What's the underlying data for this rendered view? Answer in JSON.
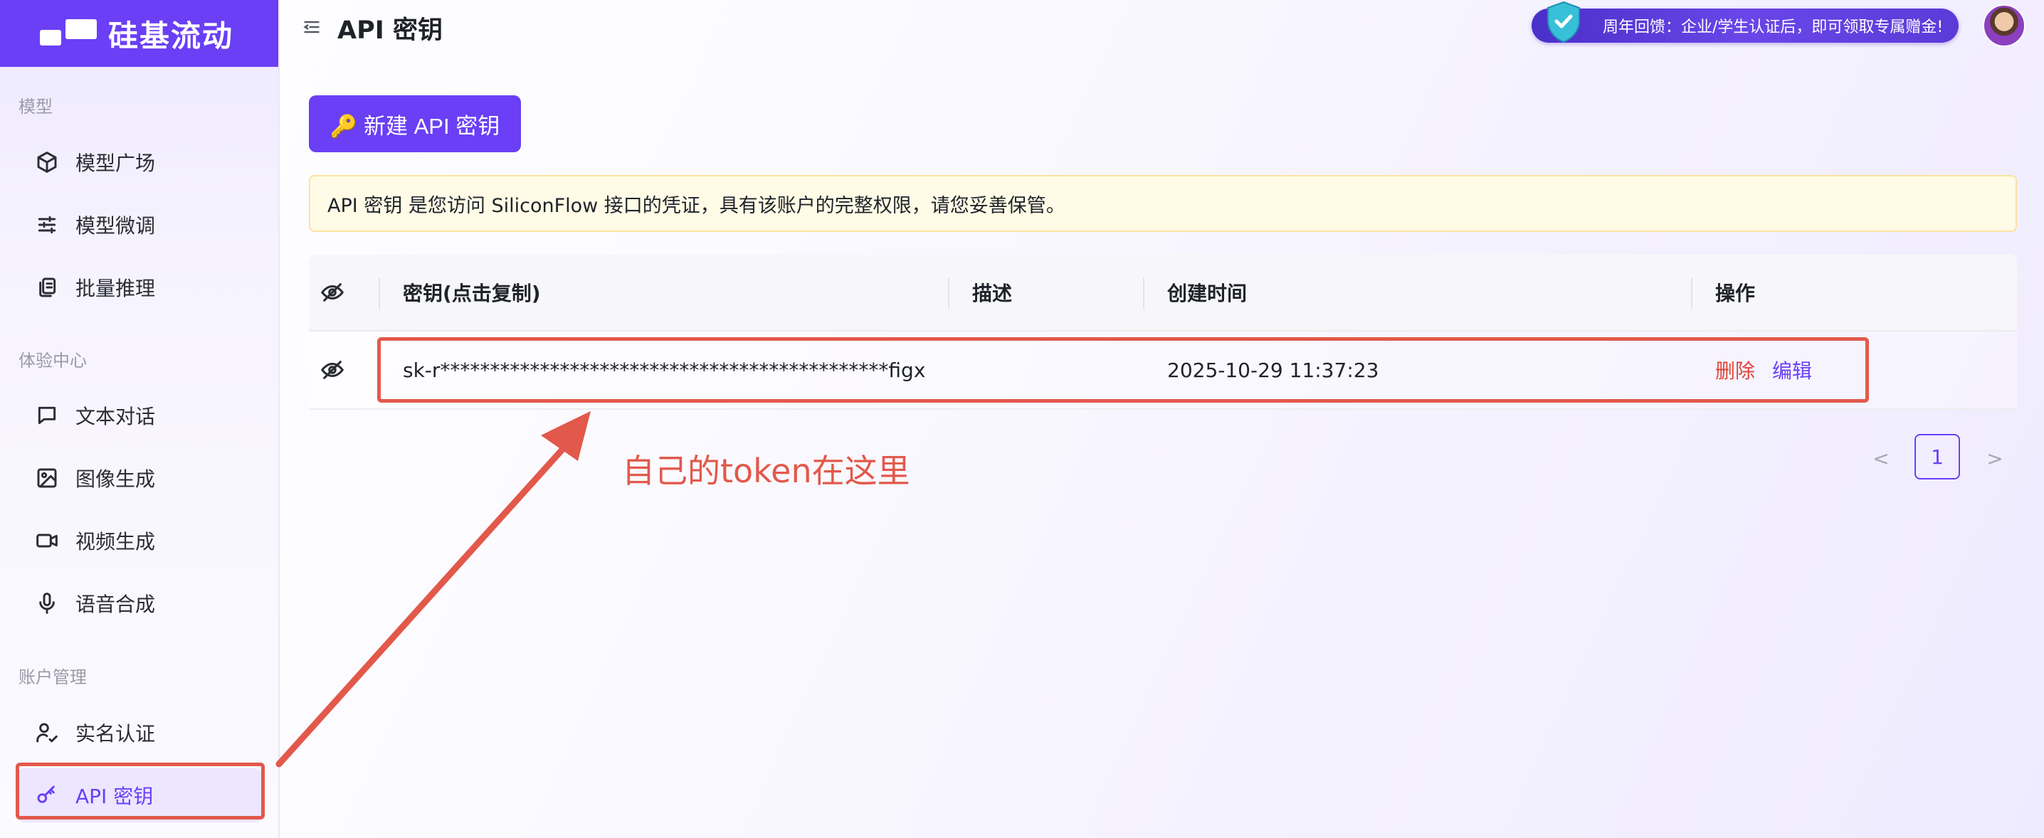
{
  "brand": {
    "name": "硅基流动"
  },
  "sidebar": {
    "sections": [
      {
        "title": "模型"
      },
      {
        "title": "体验中心"
      },
      {
        "title": "账户管理"
      }
    ],
    "items": [
      {
        "label": "模型广场",
        "icon": "cube-icon"
      },
      {
        "label": "模型微调",
        "icon": "sliders-icon"
      },
      {
        "label": "批量推理",
        "icon": "copy-icon"
      },
      {
        "label": "文本对话",
        "icon": "chat-icon"
      },
      {
        "label": "图像生成",
        "icon": "image-icon"
      },
      {
        "label": "视频生成",
        "icon": "video-icon"
      },
      {
        "label": "语音合成",
        "icon": "mic-icon"
      },
      {
        "label": "实名认证",
        "icon": "user-check-icon"
      },
      {
        "label": "API 密钥",
        "icon": "key-icon",
        "active": true
      }
    ]
  },
  "header": {
    "title": "API 密钥",
    "promo": "周年回馈：企业/学生认证后，即可领取专属赠金!"
  },
  "main": {
    "new_button": "🔑 新建 API 密钥",
    "notice": "API 密钥 是您访问 SiliconFlow 接口的凭证，具有该账户的完整权限，请您妥善保管。",
    "table": {
      "columns": [
        "密钥(点击复制)",
        "描述",
        "创建时间",
        "操作"
      ],
      "rows": [
        {
          "key": "sk-r*********************************************figx",
          "description": "",
          "created": "2025-10-29 11:37:23",
          "actions": {
            "delete": "删除",
            "edit": "编辑"
          }
        }
      ]
    },
    "pagination": {
      "prev": "<",
      "current": "1",
      "next": ">"
    }
  },
  "annotation": {
    "text": "自己的token在这里",
    "color": "#e2594b"
  },
  "colors": {
    "accent": "#6a3ff5",
    "danger": "#e2443a",
    "highlight": "#e2594b"
  }
}
